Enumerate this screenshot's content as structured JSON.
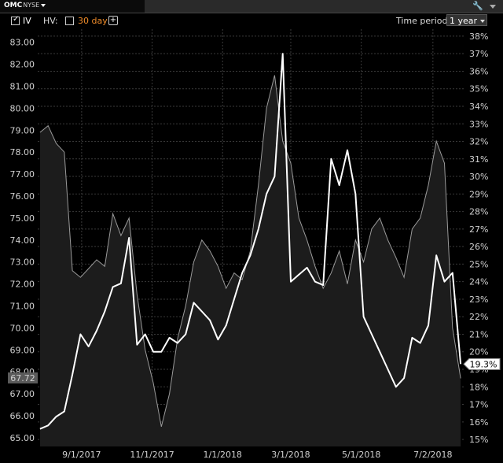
{
  "header": {
    "ticker": "OMC",
    "exchange": "NYSE",
    "iv_label": "IV",
    "iv_checked": true,
    "hv_label": "HV:",
    "hv_checked": false,
    "hv_period": "30 day",
    "add_button": "+",
    "time_period_label": "Time period:",
    "time_period_value": "1 year"
  },
  "colors": {
    "background": "#000000",
    "iv_line": "#ffffff",
    "price_area_line": "#9a9a9a",
    "hv_period_text": "#f08c2a"
  },
  "chart_data": {
    "type": "line",
    "title": "",
    "x_ticks": [
      "9/1/2017",
      "11/1/2017",
      "1/1/2018",
      "3/1/2018",
      "5/1/2018",
      "7/2/2018"
    ],
    "x_tick_dates": [
      "2017-09-01",
      "2017-11-01",
      "2018-01-01",
      "2018-03-01",
      "2018-05-01",
      "2018-07-02"
    ],
    "x_range": [
      "2017-07-25",
      "2018-07-30"
    ],
    "left_axis": {
      "label": "",
      "range": [
        64.6,
        83.6
      ],
      "ticks": [
        "65.00",
        "66.00",
        "67.00",
        "68.00",
        "69.00",
        "70.00",
        "71.00",
        "72.00",
        "73.00",
        "74.00",
        "75.00",
        "76.00",
        "77.00",
        "78.00",
        "79.00",
        "80.00",
        "81.00",
        "82.00",
        "83.00"
      ],
      "current_value_label": "67.72",
      "current_value": 67.72
    },
    "right_axis": {
      "label": "",
      "range": [
        14.6,
        38.4
      ],
      "ticks": [
        "15%",
        "16%",
        "17%",
        "18%",
        "19%",
        "20%",
        "21%",
        "22%",
        "23%",
        "24%",
        "25%",
        "26%",
        "27%",
        "28%",
        "29%",
        "30%",
        "31%",
        "32%",
        "33%",
        "34%",
        "35%",
        "36%",
        "37%",
        "38%"
      ],
      "current_value_label": "19.3%",
      "current_value": 19.3
    },
    "grid": true,
    "series": [
      {
        "name": "IV",
        "axis": "right",
        "style": "line",
        "x": [
          "2017-07-27",
          "2017-08-03",
          "2017-08-10",
          "2017-08-17",
          "2017-08-24",
          "2017-08-31",
          "2017-09-07",
          "2017-09-14",
          "2017-09-21",
          "2017-09-28",
          "2017-10-05",
          "2017-10-12",
          "2017-10-19",
          "2017-10-26",
          "2017-11-02",
          "2017-11-09",
          "2017-11-16",
          "2017-11-23",
          "2017-11-30",
          "2017-12-07",
          "2017-12-14",
          "2017-12-21",
          "2017-12-28",
          "2018-01-04",
          "2018-01-11",
          "2018-01-18",
          "2018-01-25",
          "2018-02-01",
          "2018-02-08",
          "2018-02-15",
          "2018-02-22",
          "2018-03-01",
          "2018-03-08",
          "2018-03-15",
          "2018-03-22",
          "2018-03-29",
          "2018-04-05",
          "2018-04-12",
          "2018-04-19",
          "2018-04-26",
          "2018-05-03",
          "2018-05-10",
          "2018-05-17",
          "2018-05-24",
          "2018-05-31",
          "2018-06-07",
          "2018-06-14",
          "2018-06-21",
          "2018-06-28",
          "2018-07-05",
          "2018-07-12",
          "2018-07-19",
          "2018-07-26"
        ],
        "y": [
          15.6,
          15.8,
          16.3,
          16.6,
          18.7,
          21.0,
          20.3,
          21.2,
          22.3,
          23.7,
          23.9,
          26.5,
          20.4,
          21.0,
          20.0,
          20.0,
          20.8,
          20.5,
          21.0,
          22.8,
          22.3,
          21.8,
          20.7,
          21.5,
          23.0,
          24.5,
          25.5,
          27.0,
          29.0,
          30.0,
          37.0,
          24.0,
          24.4,
          24.8,
          24.0,
          23.8,
          31.0,
          29.5,
          31.5,
          29.0,
          22.0,
          21.0,
          20.0,
          19.0,
          18.0,
          18.5,
          20.8,
          20.5,
          21.5,
          25.5,
          24.0,
          24.5,
          19.3
        ]
      },
      {
        "name": "Price",
        "axis": "left",
        "style": "area",
        "x": [
          "2017-07-27",
          "2017-08-03",
          "2017-08-10",
          "2017-08-17",
          "2017-08-24",
          "2017-08-31",
          "2017-09-07",
          "2017-09-14",
          "2017-09-21",
          "2017-09-28",
          "2017-10-05",
          "2017-10-12",
          "2017-10-19",
          "2017-10-26",
          "2017-11-02",
          "2017-11-09",
          "2017-11-16",
          "2017-11-23",
          "2017-11-30",
          "2017-12-07",
          "2017-12-14",
          "2017-12-21",
          "2017-12-28",
          "2018-01-04",
          "2018-01-11",
          "2018-01-18",
          "2018-01-25",
          "2018-02-01",
          "2018-02-08",
          "2018-02-15",
          "2018-02-22",
          "2018-03-01",
          "2018-03-08",
          "2018-03-15",
          "2018-03-22",
          "2018-03-29",
          "2018-04-05",
          "2018-04-12",
          "2018-04-19",
          "2018-04-26",
          "2018-05-03",
          "2018-05-10",
          "2018-05-17",
          "2018-05-24",
          "2018-05-31",
          "2018-06-07",
          "2018-06-14",
          "2018-06-21",
          "2018-06-28",
          "2018-07-05",
          "2018-07-12",
          "2018-07-19",
          "2018-07-26"
        ],
        "y": [
          78.9,
          79.2,
          78.4,
          78.0,
          72.6,
          72.3,
          72.7,
          73.1,
          72.8,
          75.2,
          74.2,
          75.0,
          71.5,
          69.0,
          67.5,
          65.5,
          67.0,
          69.5,
          71.0,
          73.0,
          74.0,
          73.5,
          72.8,
          71.8,
          72.5,
          72.2,
          73.5,
          76.5,
          80.0,
          81.5,
          78.5,
          77.5,
          75.0,
          74.0,
          72.8,
          71.8,
          72.5,
          73.5,
          72.0,
          74.0,
          73.0,
          74.5,
          75.0,
          74.0,
          73.2,
          72.3,
          74.5,
          75.0,
          76.5,
          78.5,
          77.5,
          70.0,
          67.7
        ]
      }
    ]
  }
}
